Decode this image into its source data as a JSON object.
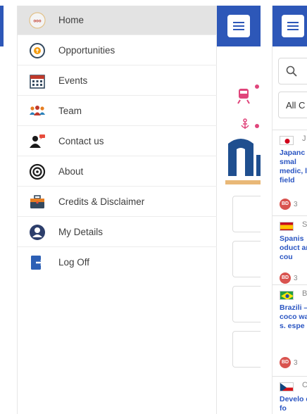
{
  "drawer": {
    "items": [
      {
        "label": "Home",
        "icon": "home-logo-icon",
        "active": true
      },
      {
        "label": "Opportunities",
        "icon": "opportunities-icon"
      },
      {
        "label": "Events",
        "icon": "calendar-icon"
      },
      {
        "label": "Team",
        "icon": "team-icon"
      },
      {
        "label": "Contact us",
        "icon": "contact-icon"
      },
      {
        "label": "About",
        "icon": "about-icon"
      },
      {
        "label": "Credits & Disclaimer",
        "icon": "briefcase-icon"
      },
      {
        "label": "My Details",
        "icon": "user-icon"
      },
      {
        "label": "Log Off",
        "icon": "logoff-icon"
      }
    ]
  },
  "right_panel": {
    "filter_value": "All C",
    "news": [
      {
        "flag": "japan-flag",
        "count": "J",
        "title": "Japanc g smal medic, l field",
        "badge": "BD",
        "badge_num": "3"
      },
      {
        "flag": "spain-flag",
        "count": "S",
        "title": "Spanis oduct an cou",
        "badge": "BD",
        "badge_num": "3"
      },
      {
        "flag": "brazil-flag",
        "count": "B",
        "title": "Brazili – coco wantir s. espe",
        "badge": "BD",
        "badge_num": "3"
      },
      {
        "flag": "czech-flag",
        "count": "C",
        "title": "Develo des fo",
        "badge": "",
        "badge_num": ""
      }
    ]
  },
  "colors": {
    "brand_blue": "#2d57b8",
    "link_blue": "#2a55c2",
    "active_row": "#e3e3e3"
  }
}
